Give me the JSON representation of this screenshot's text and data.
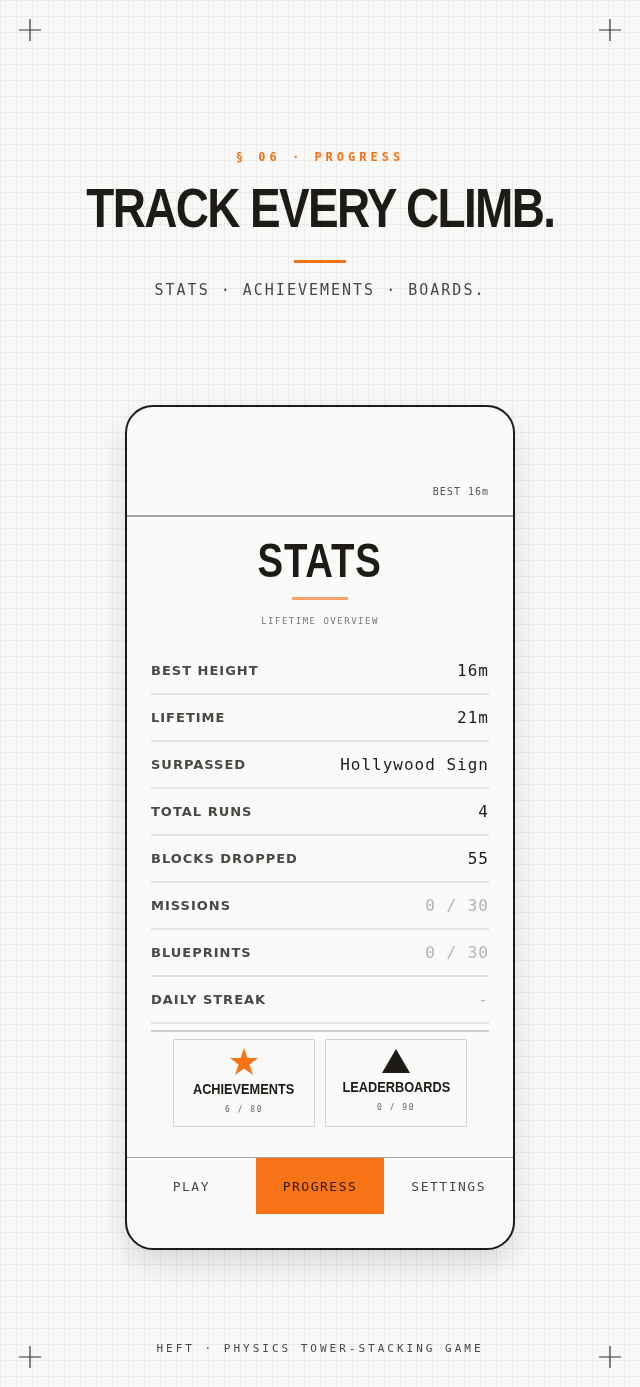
{
  "eyebrow": "§ 06 · PROGRESS",
  "headline": "TRACK EVERY CLIMB.",
  "subtitle": "STATS · ACHIEVEMENTS · BOARDS.",
  "phone": {
    "best": "BEST 16m",
    "title": "STATS",
    "caption": "LIFETIME OVERVIEW",
    "stats": [
      {
        "label": "BEST HEIGHT",
        "value": "16m",
        "dimmed": false
      },
      {
        "label": "LIFETIME",
        "value": "21m",
        "dimmed": false
      },
      {
        "label": "SURPASSED",
        "value": "Hollywood Sign",
        "dimmed": false
      },
      {
        "label": "TOTAL RUNS",
        "value": "4",
        "dimmed": false
      },
      {
        "label": "BLOCKS DROPPED",
        "value": "55",
        "dimmed": false
      },
      {
        "label": "MISSIONS",
        "value": "0 / 30",
        "dimmed": true
      },
      {
        "label": "BLUEPRINTS",
        "value": "0 / 30",
        "dimmed": true
      },
      {
        "label": "DAILY STREAK",
        "value": "-",
        "dimmed": true
      }
    ],
    "cards": [
      {
        "kind": "star",
        "title": "ACHIEVEMENTS",
        "count": "6 / 80"
      },
      {
        "kind": "triangle",
        "title": "LEADERBOARDS",
        "count": "0 / 90"
      }
    ],
    "nav": [
      {
        "label": "PLAY",
        "selected": false
      },
      {
        "label": "PROGRESS",
        "selected": true
      },
      {
        "label": "SETTINGS",
        "selected": false
      }
    ]
  },
  "footer": "HEFT · PHYSICS TOWER-STACKING GAME"
}
